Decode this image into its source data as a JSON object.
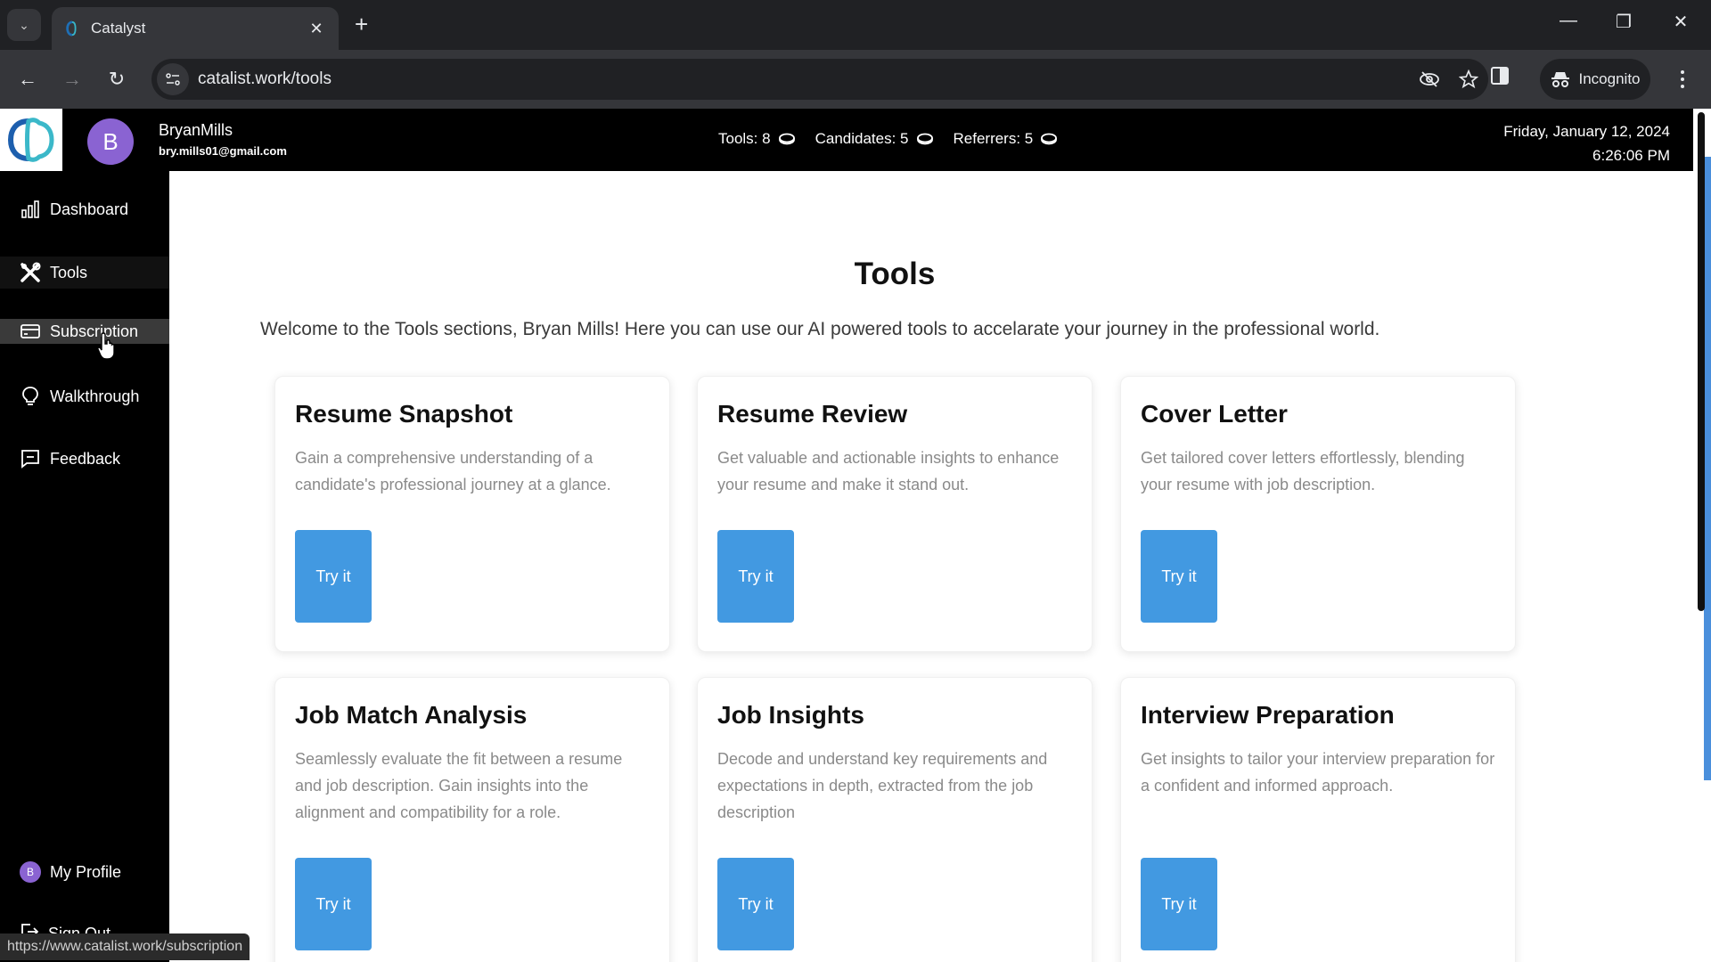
{
  "browser": {
    "tab_title": "Catalyst",
    "url": "catalist.work/tools",
    "incognito_label": "Incognito",
    "status_url": "https://www.catalist.work/subscription"
  },
  "header": {
    "avatar_initial": "B",
    "user_name": "BryanMills",
    "user_email": "bry.mills01@gmail.com",
    "stats": [
      {
        "label": "Tools: 8"
      },
      {
        "label": "Candidates: 5"
      },
      {
        "label": "Referrers: 5"
      }
    ],
    "date": "Friday, January 12, 2024",
    "time": "6:26:06 PM"
  },
  "sidebar": {
    "items": [
      {
        "label": "Dashboard",
        "icon": "bar-chart-icon"
      },
      {
        "label": "Tools",
        "icon": "tools-icon",
        "active": true
      },
      {
        "label": "Subscription",
        "icon": "credit-card-icon",
        "hover": true
      },
      {
        "label": "Walkthrough",
        "icon": "lightbulb-icon"
      },
      {
        "label": "Feedback",
        "icon": "message-icon"
      }
    ],
    "profile_label": "My Profile",
    "profile_initial": "B",
    "signout_label": "Sign Out"
  },
  "main": {
    "title": "Tools",
    "welcome": "Welcome to the Tools sections, Bryan Mills! Here you can use our AI powered tools to accelarate your journey in the professional world.",
    "cards": [
      {
        "title": "Resume Snapshot",
        "description": "Gain a comprehensive understanding of a candidate's professional journey at a glance.",
        "button": "Try it"
      },
      {
        "title": "Resume Review",
        "description": "Get valuable and actionable insights to enhance your resume and make it stand out.",
        "button": "Try it"
      },
      {
        "title": "Cover Letter",
        "description": "Get tailored cover letters effortlessly, blending your resume with job description.",
        "button": "Try it"
      },
      {
        "title": "Job Match Analysis",
        "description": "Seamlessly evaluate the fit between a resume and job description. Gain insights into the alignment and compatibility for a role.",
        "button": "Try it"
      },
      {
        "title": "Job Insights",
        "description": "Decode and understand key requirements and expectations in depth, extracted from the job description",
        "button": "Try it"
      },
      {
        "title": "Interview Preparation",
        "description": "Get insights to tailor your interview preparation for a confident and informed approach.",
        "button": "Try it"
      }
    ]
  },
  "colors": {
    "accent": "#4299e1",
    "avatar": "#8a63d2",
    "sidebar_bg": "#000000"
  }
}
